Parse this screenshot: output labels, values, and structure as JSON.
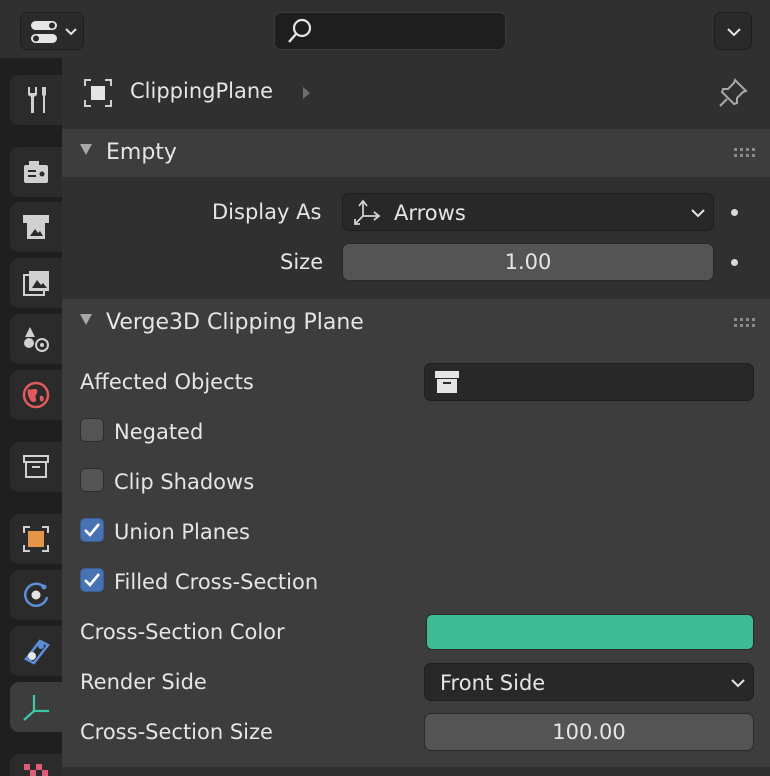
{
  "header": {
    "search_placeholder": ""
  },
  "sidebar": {
    "tabs": [
      {
        "name": "tool",
        "icon": "wrench-screwdriver-icon"
      },
      {
        "name": "render",
        "icon": "camera-back-icon"
      },
      {
        "name": "output",
        "icon": "printer-icon"
      },
      {
        "name": "view-layer",
        "icon": "images-icon"
      },
      {
        "name": "scene",
        "icon": "scene-icon"
      },
      {
        "name": "world",
        "icon": "globe-icon"
      },
      {
        "name": "collection",
        "icon": "box-icon"
      },
      {
        "name": "object",
        "icon": "object-square-icon"
      },
      {
        "name": "physics",
        "icon": "orbit-icon"
      },
      {
        "name": "constraints",
        "icon": "constraint-icon"
      },
      {
        "name": "object-data",
        "icon": "empty-axes-icon"
      },
      {
        "name": "texture",
        "icon": "checker-icon"
      }
    ],
    "active_tab": "object-data"
  },
  "breadcrumb": {
    "object_name": "ClippingPlane"
  },
  "empty_section": {
    "title": "Empty",
    "display_as_label": "Display As",
    "display_as_value": "Arrows",
    "size_label": "Size",
    "size_value": "1.00"
  },
  "clipping_section": {
    "title": "Verge3D Clipping Plane",
    "affected_objects_label": "Affected Objects",
    "negated_label": "Negated",
    "negated_checked": false,
    "clip_shadows_label": "Clip Shadows",
    "clip_shadows_checked": false,
    "union_planes_label": "Union Planes",
    "union_planes_checked": true,
    "filled_cross_section_label": "Filled Cross-Section",
    "filled_cross_section_checked": true,
    "cross_section_color_label": "Cross-Section Color",
    "cross_section_color": "#3dbb93",
    "render_side_label": "Render Side",
    "render_side_value": "Front Side",
    "cross_section_size_label": "Cross-Section Size",
    "cross_section_size_value": "100.00"
  },
  "colors": {
    "accent_blue": "#4772b3",
    "world_icon": "#e25a5a",
    "object_icon": "#e3964a",
    "physics_icon": "#5b8fd9"
  }
}
